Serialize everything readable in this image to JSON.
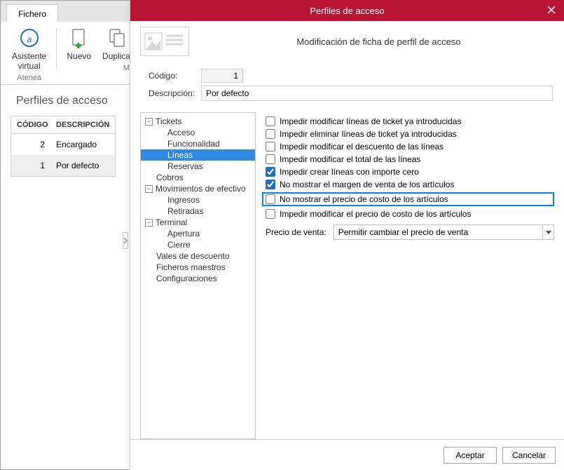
{
  "bg": {
    "tab_fichero": "Fichero",
    "ribbon": {
      "asistente_line1": "Asistente",
      "asistente_line2": "virtual",
      "group_atenea": "Atenea",
      "nuevo": "Nuevo",
      "duplicar": "Duplicar",
      "m_cut": "M",
      "group_mantenim": "Mantenim"
    },
    "page_title": "Perfiles de acceso",
    "table": {
      "col_codigo": "CÓDIGO",
      "col_desc": "DESCRIPCIÓN",
      "rows": [
        {
          "codigo": "2",
          "desc": "Encargado"
        },
        {
          "codigo": "1",
          "desc": "Por defecto"
        }
      ],
      "selected": 1
    }
  },
  "modal": {
    "title": "Perfiles de acceso",
    "subtitle": "Modificación de ficha de perfil de acceso",
    "codigo_label": "Código:",
    "codigo_value": "1",
    "desc_label": "Descripción:",
    "desc_value": "Por defecto",
    "tree": [
      {
        "label": "Tickets",
        "level": 0,
        "expand": "-",
        "sel": false
      },
      {
        "label": "Acceso",
        "level": 2,
        "sel": false
      },
      {
        "label": "Funcionalidad",
        "level": 2,
        "sel": false
      },
      {
        "label": "Líneas",
        "level": 2,
        "sel": true
      },
      {
        "label": "Reservas",
        "level": 2,
        "sel": false
      },
      {
        "label": "Cobros",
        "level": 1,
        "sel": false
      },
      {
        "label": "Movimientos de efectivo",
        "level": 0,
        "expand": "-",
        "sel": false
      },
      {
        "label": "Ingresos",
        "level": 2,
        "sel": false
      },
      {
        "label": "Retiradas",
        "level": 2,
        "sel": false
      },
      {
        "label": "Terminal",
        "level": 0,
        "expand": "-",
        "sel": false
      },
      {
        "label": "Apertura",
        "level": 2,
        "sel": false
      },
      {
        "label": "Cierre",
        "level": 2,
        "sel": false
      },
      {
        "label": "Vales de descuento",
        "level": 1,
        "sel": false
      },
      {
        "label": "Ficheros maestros",
        "level": 1,
        "sel": false
      },
      {
        "label": "Configuraciones",
        "level": 1,
        "sel": false
      }
    ],
    "options": [
      {
        "label": "Impedir modificar líneas de ticket ya introducidas",
        "checked": false,
        "hl": false
      },
      {
        "label": "Impedir eliminar líneas de ticket ya introducidas",
        "checked": false,
        "hl": false
      },
      {
        "label": "Impedir modificar el descuento de las líneas",
        "checked": false,
        "hl": false
      },
      {
        "label": "Impedir modificar el total de las líneas",
        "checked": false,
        "hl": false
      },
      {
        "label": "Impedir crear líneas con importe cero",
        "checked": true,
        "hl": false
      },
      {
        "label": "No mostrar el margen de venta de los artículos",
        "checked": true,
        "hl": false
      },
      {
        "label": "No mostrar el precio de costo de los artículos",
        "checked": false,
        "hl": true
      },
      {
        "label": "Impedir modificar el precio de costo de los artículos",
        "checked": false,
        "hl": false
      }
    ],
    "precio_label": "Precio de venta:",
    "precio_value": "Permitir cambiar el precio de venta",
    "btn_ok": "Aceptar",
    "btn_cancel": "Cancelar"
  }
}
